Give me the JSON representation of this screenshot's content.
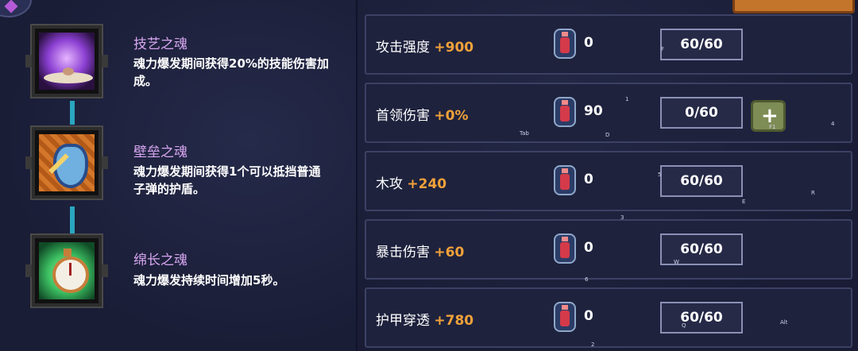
{
  "souls": [
    {
      "title": "技艺之魂",
      "description": "魂力爆发期间获得20%的技能伤害加成。",
      "icon": "purple-crystal-soul-icon",
      "color": "#8a3fd1"
    },
    {
      "title": "壁垒之魂",
      "description": "魂力爆发期间获得1个可以抵挡普通子弹的护盾。",
      "icon": "shield-soul-icon",
      "color": "#d4772a"
    },
    {
      "title": "绵长之魂",
      "description": "魂力爆发持续时间增加5秒。",
      "icon": "stopwatch-soul-icon",
      "color": "#3cbf62"
    }
  ],
  "stats": [
    {
      "name": "攻击强度",
      "bonus": "+900",
      "count": "0",
      "level": "60/60",
      "can_upgrade": false
    },
    {
      "name": "首领伤害",
      "bonus": "+0%",
      "count": "90",
      "level": "0/60",
      "can_upgrade": true
    },
    {
      "name": "木攻",
      "bonus": "+240",
      "count": "0",
      "level": "60/60",
      "can_upgrade": false
    },
    {
      "name": "暴击伤害",
      "bonus": "+60",
      "count": "0",
      "level": "60/60",
      "can_upgrade": false
    },
    {
      "name": "护甲穿透",
      "bonus": "+780",
      "count": "0",
      "level": "60/60",
      "can_upgrade": false
    }
  ],
  "key_hints": [
    "F",
    "1",
    "Tab",
    "D",
    "4",
    "F1",
    "5",
    "R",
    "E",
    "3",
    "W",
    "6",
    "Q",
    "Alt",
    "2"
  ],
  "colors": {
    "accent": "#f1a13a",
    "soul_title": "#d7a6f0",
    "connector": "#2aa6c0"
  }
}
